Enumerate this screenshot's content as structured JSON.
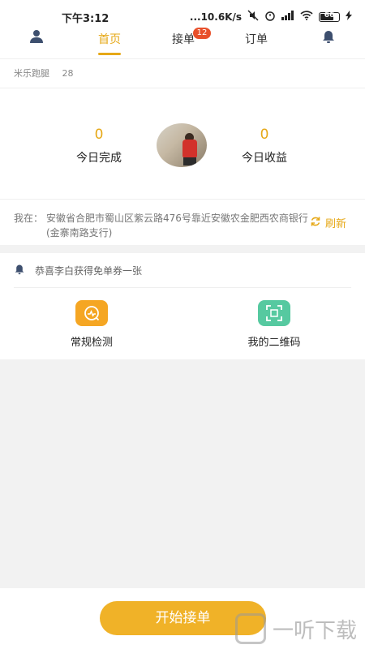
{
  "status": {
    "time": "下午3:12",
    "network": "...10.6K/s",
    "battery": "66"
  },
  "nav": {
    "tabs": [
      {
        "label": "首页"
      },
      {
        "label": "接单",
        "badge": "12"
      },
      {
        "label": "订单"
      }
    ]
  },
  "user": {
    "name": "米乐跑腿",
    "count": "28"
  },
  "stats": {
    "completed_num": "0",
    "completed_label": "今日完成",
    "income_num": "0",
    "income_label": "今日收益"
  },
  "location": {
    "label": "我在：",
    "address": "安徽省合肥市蜀山区紫云路476号靠近安徽农金肥西农商银行(金寨南路支行)",
    "refresh": "刷新"
  },
  "notice": {
    "text": "恭喜李白获得免单券一张"
  },
  "actions": [
    {
      "label": "常规检测",
      "icon": "chart-pulse-icon",
      "color": "#f5a623"
    },
    {
      "label": "我的二维码",
      "icon": "qr-scan-icon",
      "color": "#56c9a0"
    }
  ],
  "start_button": "开始接单",
  "watermark": "一听下载",
  "colors": {
    "accent": "#e6a817",
    "badge": "#e8502b",
    "button": "#f0b228"
  }
}
